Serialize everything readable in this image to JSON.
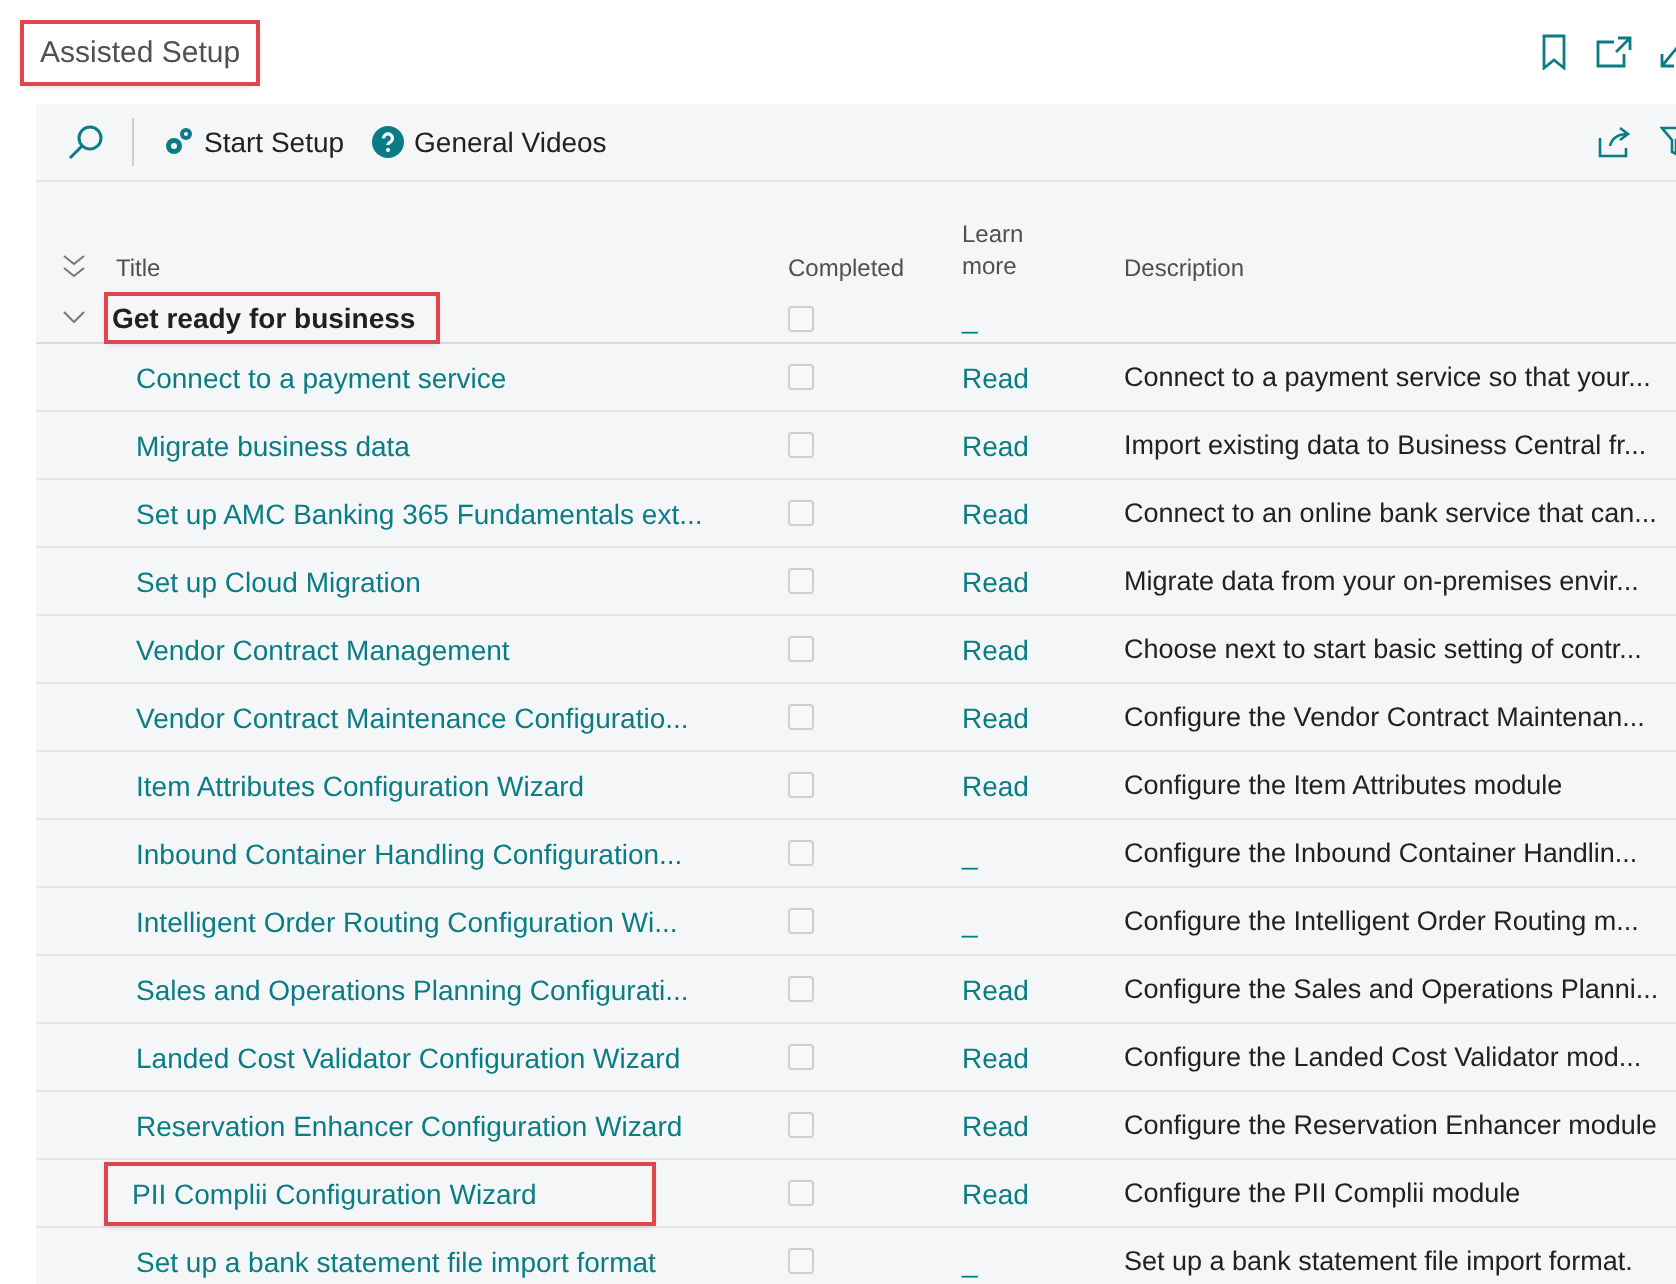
{
  "page": {
    "title": "Assisted Setup",
    "highlighted": true
  },
  "actions": [
    {
      "kind": "start",
      "label": "Start Setup"
    },
    {
      "kind": "videos",
      "label": "General Videos"
    }
  ],
  "columns": {
    "title": "Title",
    "completed": "Completed",
    "learn_more": "Learn more",
    "description": "Description"
  },
  "group": {
    "title": "Get ready for business",
    "expanded": true,
    "completed": false,
    "learn_more": "_",
    "highlighted": true
  },
  "rows": [
    {
      "title": "Connect to a payment service",
      "completed": false,
      "learn_more": "Read",
      "description": "Connect to a payment service so that your...",
      "highlighted": false
    },
    {
      "title": "Migrate business data",
      "completed": false,
      "learn_more": "Read",
      "description": "Import existing data to Business Central fr...",
      "highlighted": false
    },
    {
      "title": "Set up AMC Banking 365 Fundamentals ext...",
      "completed": false,
      "learn_more": "Read",
      "description": "Connect to an online bank service that can...",
      "highlighted": false
    },
    {
      "title": "Set up Cloud Migration",
      "completed": false,
      "learn_more": "Read",
      "description": "Migrate data from your on-premises envir...",
      "highlighted": false
    },
    {
      "title": "Vendor Contract Management",
      "completed": false,
      "learn_more": "Read",
      "description": "Choose next to start basic setting of contr...",
      "highlighted": false
    },
    {
      "title": "Vendor Contract Maintenance Configuratio...",
      "completed": false,
      "learn_more": "Read",
      "description": "Configure the Vendor Contract Maintenan...",
      "highlighted": false
    },
    {
      "title": "Item Attributes Configuration Wizard",
      "completed": false,
      "learn_more": "Read",
      "description": "Configure the Item Attributes module",
      "highlighted": false
    },
    {
      "title": "Inbound Container Handling Configuration...",
      "completed": false,
      "learn_more": "_",
      "description": "Configure the Inbound Container Handlin...",
      "highlighted": false
    },
    {
      "title": "Intelligent Order Routing Configuration Wi...",
      "completed": false,
      "learn_more": "_",
      "description": "Configure the Intelligent Order Routing m...",
      "highlighted": false
    },
    {
      "title": "Sales and Operations Planning Configurati...",
      "completed": false,
      "learn_more": "Read",
      "description": "Configure the Sales and Operations Planni...",
      "highlighted": false
    },
    {
      "title": "Landed Cost Validator Configuration Wizard",
      "completed": false,
      "learn_more": "Read",
      "description": "Configure the Landed Cost Validator mod...",
      "highlighted": false
    },
    {
      "title": "Reservation Enhancer Configuration Wizard",
      "completed": false,
      "learn_more": "Read",
      "description": "Configure the Reservation Enhancer module",
      "highlighted": false
    },
    {
      "title": "PII Complii Configuration Wizard",
      "completed": false,
      "learn_more": "Read",
      "description": "Configure the PII Complii module",
      "highlighted": true
    },
    {
      "title": "Set up a bank statement file import format",
      "completed": false,
      "learn_more": "_",
      "description": "Set up a bank statement file import format.",
      "highlighted": false
    }
  ]
}
